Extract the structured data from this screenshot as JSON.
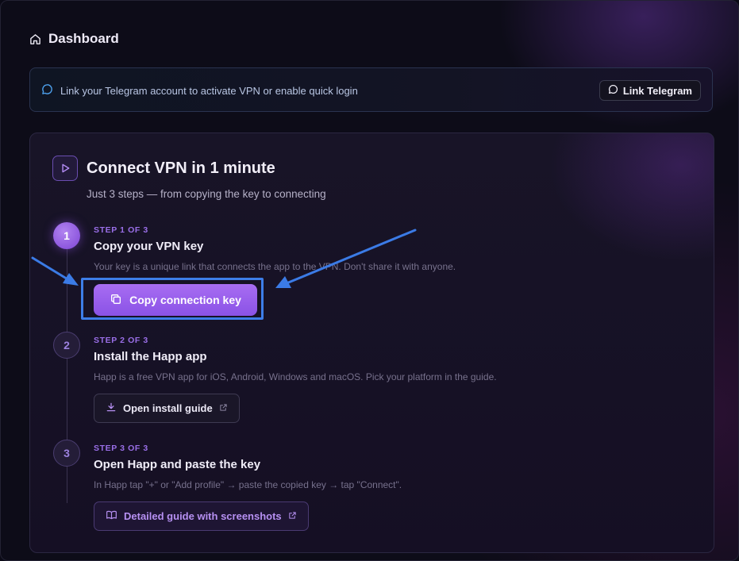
{
  "header": {
    "title": "Dashboard",
    "icon": "home-icon"
  },
  "telegram_banner": {
    "message": "Link your Telegram account to activate VPN or enable quick login",
    "button_label": "Link Telegram",
    "icon": "chat-bubble-icon"
  },
  "connect_card": {
    "title": "Connect VPN in 1 minute",
    "subtitle": "Just 3 steps — from copying the key to connecting",
    "icon": "play-icon",
    "steps": [
      {
        "number": "1",
        "label": "STEP 1 OF 3",
        "title": "Copy your VPN key",
        "description": "Your key is a unique link that connects the app to the VPN. Don't share it with anyone.",
        "button_label": "Copy connection key",
        "button_icon": "copy-icon",
        "active": true
      },
      {
        "number": "2",
        "label": "STEP 2 OF 3",
        "title": "Install the Happ app",
        "description": "Happ is a free VPN app for iOS, Android, Windows and macOS. Pick your platform in the guide.",
        "button_label": "Open install guide",
        "button_icon": "download-icon",
        "trailing_icon": "external-link-icon"
      },
      {
        "number": "3",
        "label": "STEP 3 OF 3",
        "title": "Open Happ and paste the key",
        "description": "In Happ tap \"+\" or \"Add profile\" → paste the copied key → tap \"Connect\".",
        "button_label": "Detailed guide with screenshots",
        "button_icon": "book-icon",
        "trailing_icon": "external-link-icon"
      }
    ]
  },
  "colors": {
    "accent": "#9b5ff0",
    "highlight": "#3d7ee8",
    "background": "#0d0c18"
  }
}
